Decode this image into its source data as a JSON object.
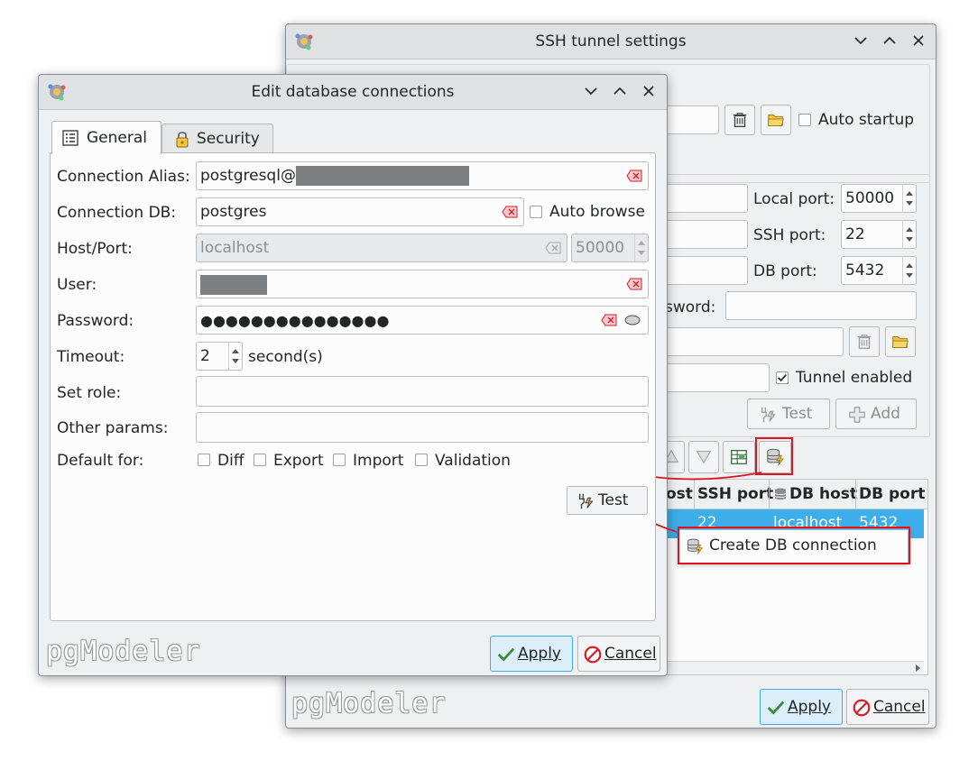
{
  "ssh_window": {
    "title": "SSH tunnel settings",
    "auto_startup_label": "Auto startup",
    "local_port_label": "Local port:",
    "local_port_value": "50000",
    "ssh_port_label": "SSH port:",
    "ssh_port_value": "22",
    "db_port_label": "DB port:",
    "db_port_value": "5432",
    "password_label_partial": "sword:",
    "tunnel_enabled_label": "Tunnel enabled",
    "test_label": "Test",
    "add_label": "Add",
    "table_headers": [
      "ost",
      "SSH port",
      "DB host",
      "DB port"
    ],
    "table_row": [
      "",
      "22",
      "localhost",
      "5432"
    ],
    "context_menu_item": "Create DB connection",
    "apply_label": "Apply",
    "cancel_label": "Cancel",
    "logo": "pgModeler"
  },
  "edit_window": {
    "title": "Edit database connections",
    "tabs": [
      {
        "label": "General",
        "active": true
      },
      {
        "label": "Security",
        "active": false
      }
    ],
    "alias_label": "Connection Alias:",
    "alias_value": "postgresql@",
    "db_label": "Connection DB:",
    "db_value": "postgres",
    "auto_browse_label": "Auto browse",
    "host_label": "Host/Port:",
    "host_placeholder": "localhost",
    "port_placeholder": "50000",
    "user_label": "User:",
    "password_label": "Password:",
    "password_value": "●●●●●●●●●●●●●●●",
    "timeout_label": "Timeout:",
    "timeout_value": "2",
    "timeout_unit": "second(s)",
    "set_role_label": "Set role:",
    "other_params_label": "Other params:",
    "default_for_label": "Default for:",
    "default_options": [
      "Diff",
      "Export",
      "Import",
      "Validation"
    ],
    "test_label": "Test",
    "apply_label": "Apply",
    "cancel_label": "Cancel",
    "logo": "pgModeler"
  },
  "colors": {
    "selection": "#3daee9",
    "annotation": "#e0141e",
    "clear_icon": "#d0202c"
  }
}
